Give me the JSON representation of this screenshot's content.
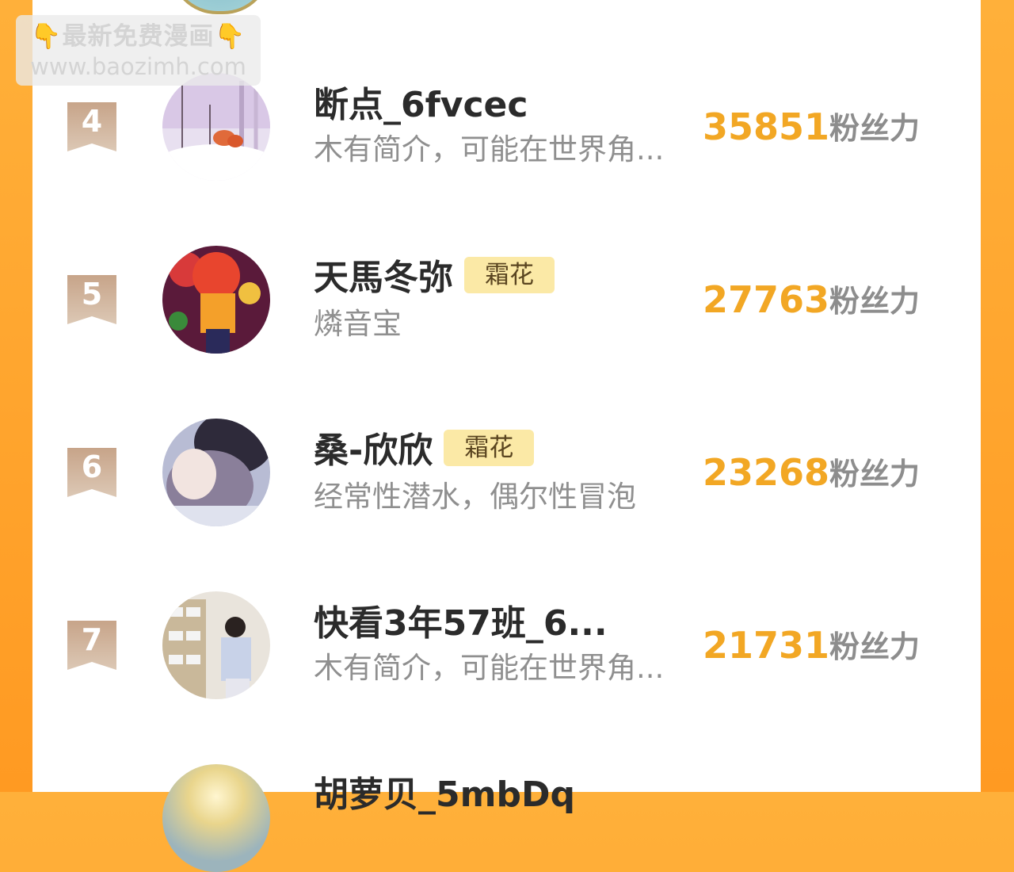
{
  "watermark": {
    "line1": "最新免费漫画",
    "line2": "www.baozimh.com",
    "emoji": "👇"
  },
  "score_unit": "粉丝力",
  "rows": [
    {
      "rank": "4",
      "name": "断点_6fvcec",
      "badge": "",
      "desc": "木有简介，可能在世界角...",
      "score": "35851",
      "avatar_icon": "fox-snow-avatar"
    },
    {
      "rank": "5",
      "name": "天馬冬弥",
      "badge": "霜花",
      "desc": "燐音宝",
      "score": "27763",
      "avatar_icon": "anime-redhair-avatar"
    },
    {
      "rank": "6",
      "name": "桑-欣欣",
      "badge": "霜花",
      "desc": "经常性潜水，偶尔性冒泡",
      "score": "23268",
      "avatar_icon": "anime-couple-avatar"
    },
    {
      "rank": "7",
      "name": "快看3年57班_6...",
      "badge": "",
      "desc": "木有简介，可能在世界角...",
      "score": "21731",
      "avatar_icon": "girl-photo-avatar"
    }
  ],
  "next_row_partial_name": "胡萝贝_5mbDq",
  "colors": {
    "background": "#ffa52e",
    "score": "#f2a724",
    "badge_bg": "#fbe9a6",
    "rank_badge": "#c9ab93"
  }
}
